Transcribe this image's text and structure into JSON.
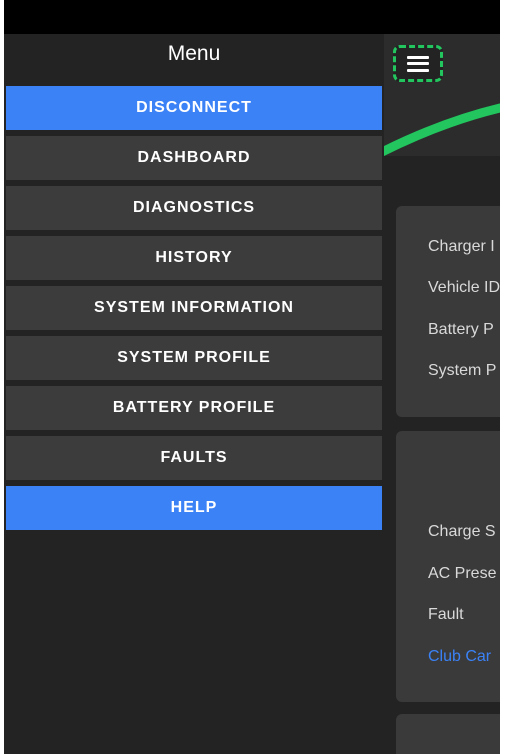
{
  "menu": {
    "title": "Menu",
    "items": [
      {
        "label": "DISCONNECT",
        "highlighted": true
      },
      {
        "label": "DASHBOARD",
        "highlighted": false
      },
      {
        "label": "DIAGNOSTICS",
        "highlighted": false
      },
      {
        "label": "HISTORY",
        "highlighted": false
      },
      {
        "label": "SYSTEM INFORMATION",
        "highlighted": false
      },
      {
        "label": "SYSTEM PROFILE",
        "highlighted": false
      },
      {
        "label": "BATTERY PROFILE",
        "highlighted": false
      },
      {
        "label": "FAULTS",
        "highlighted": false
      },
      {
        "label": "HELP",
        "highlighted": true
      }
    ]
  },
  "background": {
    "card1": {
      "rows": [
        "Charger I",
        "Vehicle ID",
        "Battery P",
        "System P"
      ]
    },
    "card2": {
      "rows": [
        "Charge S",
        "AC Prese",
        "Fault"
      ],
      "link": "Club Car"
    }
  },
  "colors": {
    "accent": "#3b82f6",
    "brand_green": "#22c55e",
    "menu_item_bg": "#3c3c3c",
    "background": "#232323"
  },
  "icons": {
    "hamburger": "menu-icon"
  }
}
